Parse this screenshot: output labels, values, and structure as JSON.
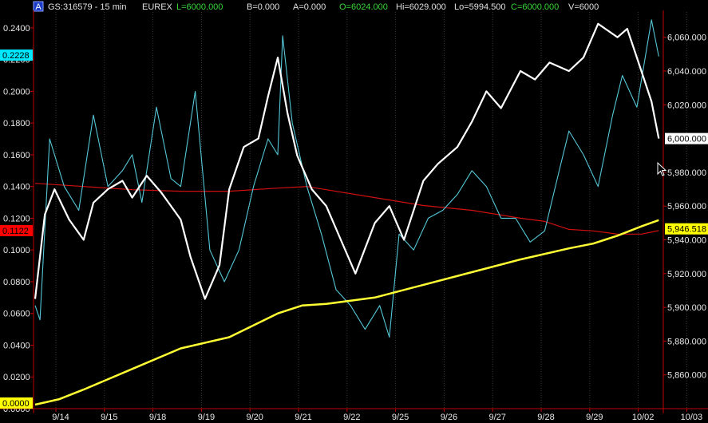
{
  "header": {
    "icon_label": "A",
    "symbol": "GS:316579 - 15 min",
    "exchange": "EUREX",
    "last": "L=6000.000",
    "bid": "B=0.000",
    "ask": "A=0.000",
    "open": "O=6024.000",
    "high": "Hi=6029.000",
    "low": "Lo=5994.500",
    "close": "C=6000.000",
    "volume": "V=6000"
  },
  "colors": {
    "background": "#000000",
    "grid": "#3a3a3a",
    "axis": "#c00000",
    "price": "#ffffff",
    "oscillator": "#55c8d8",
    "ma_red": "#d01010",
    "ma_yellow": "#ffff33",
    "left_tag_cyan": "#00e8ff",
    "left_tag_red": "#ff0000",
    "left_tag_yellow": "#ffff00",
    "right_tag_white": "#ffffff",
    "right_tag_yellow": "#ffff00"
  },
  "chart_data": {
    "type": "line",
    "grid": true,
    "x_labels": [
      "9/14",
      "9/15",
      "9/18",
      "9/19",
      "9/20",
      "9/21",
      "9/22",
      "9/25",
      "9/26",
      "9/27",
      "9/28",
      "9/29",
      "10/02",
      "10/03"
    ],
    "left_axis": {
      "range": [
        0.0,
        0.25
      ],
      "ticks": [
        "0.2400",
        "0.2200",
        "0.2000",
        "0.1800",
        "0.1600",
        "0.1400",
        "0.1200",
        "0.1000",
        "0.0800",
        "0.0600",
        "0.0400",
        "0.0200",
        "0.0000"
      ]
    },
    "right_axis": {
      "range": [
        5840,
        6075
      ],
      "ticks": [
        "6,060.000",
        "6,040.000",
        "6,020.000",
        "5,980.000",
        "5,960.000",
        "5,940.000",
        "5,920.000",
        "5,900.000",
        "5,880.000",
        "5,860.000"
      ]
    },
    "left_tags": [
      {
        "label": "0.2228",
        "value": 0.2228,
        "style": "cyan"
      },
      {
        "label": "0.1122",
        "value": 0.1122,
        "style": "red"
      },
      {
        "label": "0.0000",
        "value": 0.0,
        "style": "yellow"
      }
    ],
    "right_tags": [
      {
        "label": "6,000.000",
        "value": 6000.0,
        "style": "white"
      },
      {
        "label": "5,946.518",
        "value": 5946.518,
        "style": "yellow"
      }
    ],
    "series": [
      {
        "axis": "right",
        "color_key": "price",
        "width": 2.2,
        "x": [
          0,
          0.2,
          0.4,
          0.7,
          1,
          1.2,
          1.5,
          1.8,
          2,
          2.3,
          2.6,
          3,
          3.2,
          3.5,
          3.8,
          4,
          4.3,
          4.6,
          4.8,
          5,
          5.2,
          5.4,
          5.7,
          6,
          6.3,
          6.6,
          7,
          7.3,
          7.6,
          8,
          8.3,
          8.7,
          9,
          9.3,
          9.6,
          10,
          10.3,
          10.6,
          11,
          11.3,
          11.6,
          12,
          12.2,
          12.4,
          12.7,
          12.85
        ],
        "y": [
          5905,
          5955,
          5970,
          5952,
          5940,
          5962,
          5970,
          5975,
          5965,
          5978,
          5968,
          5952,
          5930,
          5905,
          5925,
          5970,
          5995,
          6000,
          6025,
          6048,
          6015,
          5990,
          5970,
          5960,
          5940,
          5920,
          5950,
          5960,
          5940,
          5975,
          5985,
          5995,
          6010,
          6028,
          6018,
          6040,
          6035,
          6045,
          6040,
          6048,
          6068,
          6060,
          6065,
          6048,
          6022,
          6000
        ]
      },
      {
        "axis": "left",
        "color_key": "oscillator",
        "width": 1.1,
        "x": [
          0,
          0.1,
          0.3,
          0.6,
          0.9,
          1.2,
          1.5,
          1.8,
          2,
          2.2,
          2.5,
          2.8,
          3,
          3.3,
          3.6,
          3.9,
          4.2,
          4.5,
          4.8,
          5,
          5.1,
          5.3,
          5.6,
          5.9,
          6.2,
          6.5,
          6.8,
          7.1,
          7.3,
          7.5,
          7.8,
          8.1,
          8.4,
          8.7,
          9,
          9.3,
          9.6,
          9.9,
          10.2,
          10.5,
          10.8,
          11,
          11.3,
          11.6,
          11.9,
          12.1,
          12.4,
          12.7,
          12.85
        ],
        "y": [
          0.065,
          0.056,
          0.17,
          0.14,
          0.125,
          0.185,
          0.14,
          0.15,
          0.16,
          0.13,
          0.19,
          0.145,
          0.14,
          0.2,
          0.1,
          0.08,
          0.1,
          0.14,
          0.17,
          0.16,
          0.235,
          0.18,
          0.14,
          0.11,
          0.075,
          0.065,
          0.05,
          0.065,
          0.045,
          0.11,
          0.1,
          0.12,
          0.125,
          0.135,
          0.15,
          0.14,
          0.12,
          0.12,
          0.105,
          0.112,
          0.15,
          0.175,
          0.16,
          0.14,
          0.185,
          0.21,
          0.19,
          0.245,
          0.222
        ]
      },
      {
        "axis": "left",
        "color_key": "ma_red",
        "width": 1.2,
        "x": [
          0,
          1,
          2,
          3,
          4,
          5,
          5.6,
          6,
          7,
          8,
          9,
          10,
          10.5,
          11,
          11.5,
          12,
          12.5,
          12.85
        ],
        "y": [
          0.142,
          0.14,
          0.138,
          0.137,
          0.137,
          0.139,
          0.14,
          0.138,
          0.133,
          0.128,
          0.125,
          0.12,
          0.118,
          0.113,
          0.112,
          0.11,
          0.11,
          0.1122
        ]
      },
      {
        "axis": "left",
        "color_key": "ma_yellow",
        "width": 2.5,
        "x": [
          0,
          0.5,
          1,
          2,
          3,
          4,
          5,
          5.5,
          6,
          7,
          8,
          9,
          10,
          11,
          11.5,
          12,
          12.5,
          12.85
        ],
        "y": [
          0.0025,
          0.006,
          0.012,
          0.025,
          0.038,
          0.045,
          0.06,
          0.065,
          0.066,
          0.07,
          0.078,
          0.086,
          0.094,
          0.101,
          0.104,
          0.109,
          0.115,
          0.1188
        ]
      }
    ]
  }
}
